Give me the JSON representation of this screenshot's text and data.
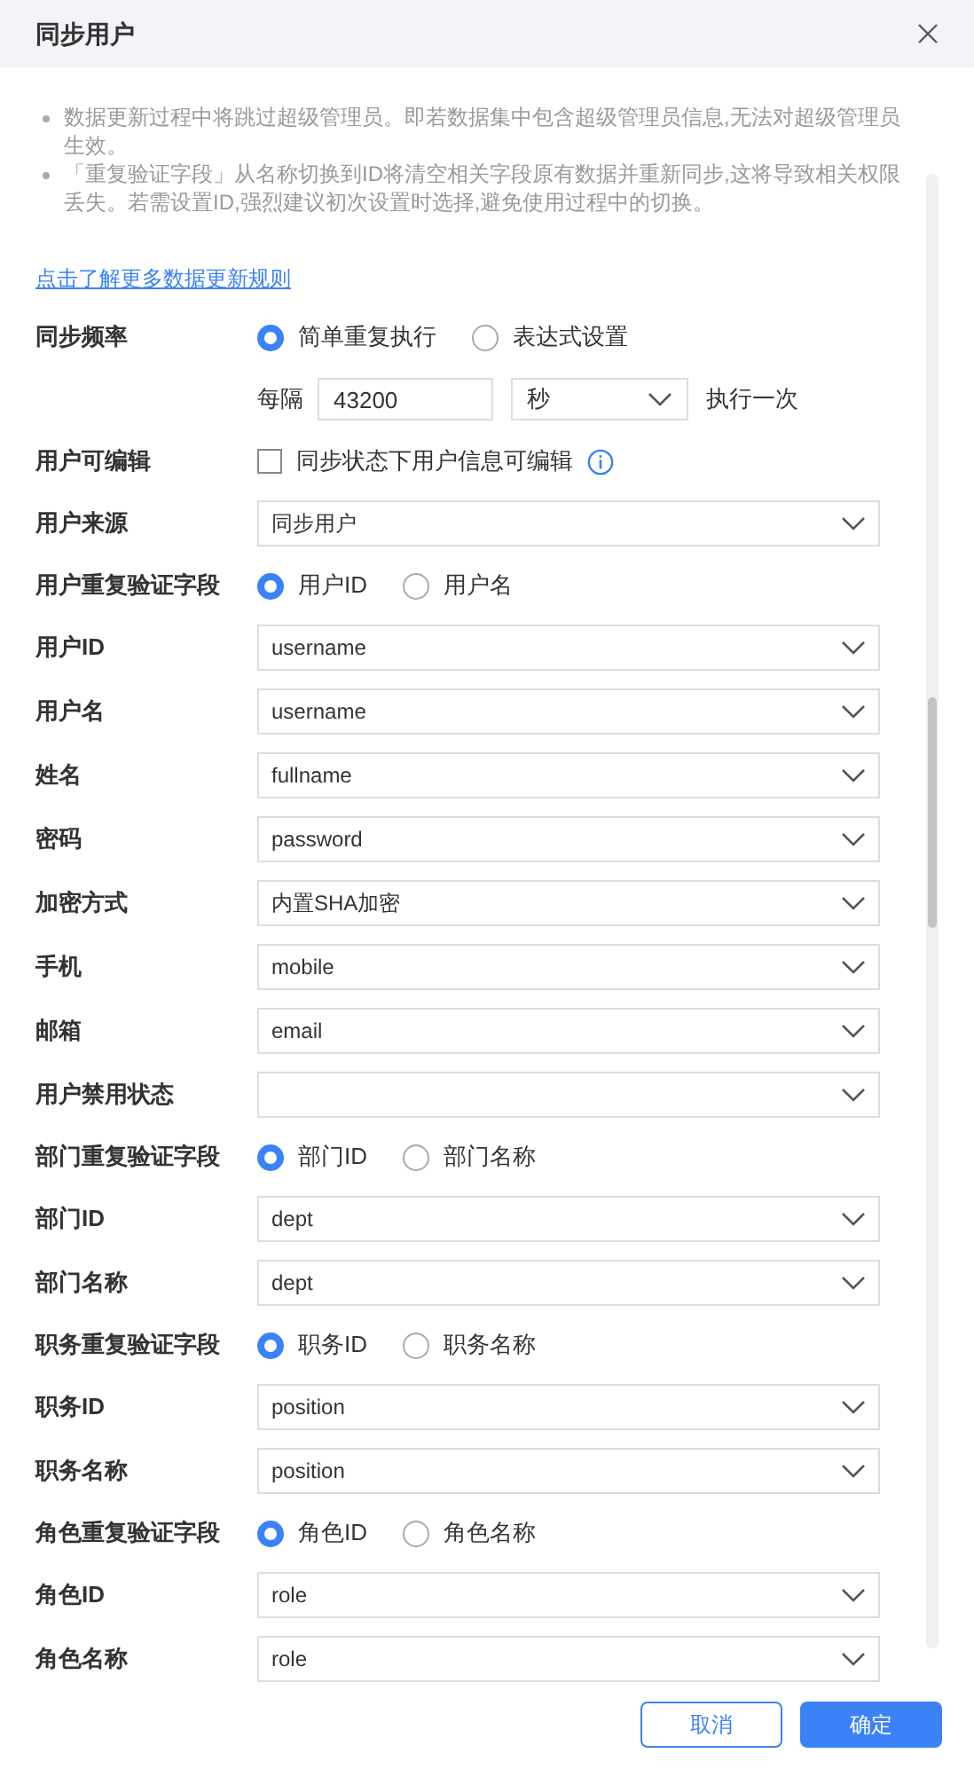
{
  "dialog": {
    "title": "同步用户"
  },
  "notes": [
    "数据更新过程中将跳过超级管理员。即若数据集中包含超级管理员信息,无法对超级管理员生效。",
    "「重复验证字段」从名称切换到ID将清空相关字段原有数据并重新同步,这将导致相关权限丢失。若需设置ID,强烈建议初次设置时选择,避免使用过程中的切换。"
  ],
  "rules_link": "点击了解更多数据更新规则",
  "rows": [
    {
      "kind": "radio",
      "label": "同步频率",
      "options": [
        {
          "label": "简单重复执行",
          "selected": true
        },
        {
          "label": "表达式设置",
          "selected": false
        }
      ]
    },
    {
      "kind": "interval",
      "prefix": "每隔",
      "value": "43200",
      "unit": "秒",
      "suffix": "执行一次"
    },
    {
      "kind": "checkbox",
      "label": "用户可编辑",
      "text": "同步状态下用户信息可编辑",
      "checked": false
    },
    {
      "kind": "select",
      "label": "用户来源",
      "value": "同步用户"
    },
    {
      "kind": "radio",
      "label": "用户重复验证字段",
      "options": [
        {
          "label": "用户ID",
          "selected": true
        },
        {
          "label": "用户名",
          "selected": false
        }
      ]
    },
    {
      "kind": "select",
      "label": "用户ID",
      "value": "username"
    },
    {
      "kind": "select",
      "label": "用户名",
      "value": "username"
    },
    {
      "kind": "select",
      "label": "姓名",
      "value": "fullname"
    },
    {
      "kind": "select",
      "label": "密码",
      "value": "password"
    },
    {
      "kind": "select",
      "label": "加密方式",
      "value": "内置SHA加密"
    },
    {
      "kind": "select",
      "label": "手机",
      "value": "mobile"
    },
    {
      "kind": "select",
      "label": "邮箱",
      "value": "email"
    },
    {
      "kind": "select",
      "label": "用户禁用状态"
    },
    {
      "kind": "radio",
      "label": "部门重复验证字段",
      "options": [
        {
          "label": "部门ID",
          "selected": true
        },
        {
          "label": "部门名称",
          "selected": false
        }
      ]
    },
    {
      "kind": "select",
      "label": "部门ID",
      "value": "dept"
    },
    {
      "kind": "select",
      "label": "部门名称",
      "value": "dept"
    },
    {
      "kind": "radio",
      "label": "职务重复验证字段",
      "options": [
        {
          "label": "职务ID",
          "selected": true
        },
        {
          "label": "职务名称",
          "selected": false
        }
      ]
    },
    {
      "kind": "select",
      "label": "职务ID",
      "value": "position"
    },
    {
      "kind": "select",
      "label": "职务名称",
      "value": "position"
    },
    {
      "kind": "radio",
      "label": "角色重复验证字段",
      "options": [
        {
          "label": "角色ID",
          "selected": true
        },
        {
          "label": "角色名称",
          "selected": false
        }
      ]
    },
    {
      "kind": "select",
      "label": "角色ID",
      "value": "role"
    },
    {
      "kind": "select",
      "label": "角色名称",
      "value": "role"
    }
  ],
  "buttons": [
    {
      "kind": "secondary",
      "label": "取消"
    },
    {
      "kind": "primary",
      "label": "确定"
    }
  ]
}
